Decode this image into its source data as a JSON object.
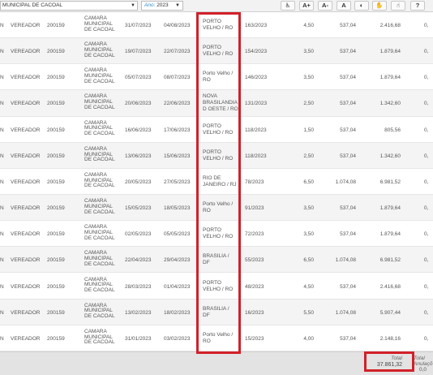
{
  "filters": {
    "entity_value": "MUNICIPAL DE CACOAL",
    "year_label": "Ano:",
    "year_value": "2023"
  },
  "toolbar_buttons": [
    {
      "name": "accessibility-icon",
      "glyph": "♿"
    },
    {
      "name": "font-increase-button",
      "glyph": "A+"
    },
    {
      "name": "font-decrease-button",
      "glyph": "A-"
    },
    {
      "name": "font-reset-button",
      "glyph": "A"
    },
    {
      "name": "contrast-icon",
      "glyph": "◐"
    },
    {
      "name": "libras-icon",
      "glyph": "✋"
    },
    {
      "name": "hand-icon",
      "glyph": "☝"
    },
    {
      "name": "help-icon",
      "glyph": "?"
    }
  ],
  "rows": [
    {
      "first": "N",
      "role": "VEREADOR",
      "code": "200159",
      "orgao": [
        "CAMARA",
        "MUNICIPAL",
        "DE CACOAL"
      ],
      "saida": "31/07/2023",
      "retorno": "04/08/2023",
      "destino": [
        "PORTO",
        "VELHO / RO"
      ],
      "doc": "163/2023",
      "qtd": "4,50",
      "unit": "537,04",
      "total": "2.416,68",
      "last": "0,"
    },
    {
      "first": "N",
      "role": "VEREADOR",
      "code": "200159",
      "orgao": [
        "CAMARA",
        "MUNICIPAL",
        "DE CACOAL"
      ],
      "saida": "19/07/2023",
      "retorno": "22/07/2023",
      "destino": [
        "PORTO",
        "VELHO / RO"
      ],
      "doc": "154/2023",
      "qtd": "3,50",
      "unit": "537,04",
      "total": "1.879,64",
      "last": "0,"
    },
    {
      "first": "N",
      "role": "VEREADOR",
      "code": "200159",
      "orgao": [
        "CAMARA",
        "MUNICIPAL",
        "DE CACOAL"
      ],
      "saida": "05/07/2023",
      "retorno": "08/07/2023",
      "destino": [
        "Porto Velho /",
        "RO"
      ],
      "doc": "146/2023",
      "qtd": "3,50",
      "unit": "537,04",
      "total": "1.879,64",
      "last": "0,"
    },
    {
      "first": "N",
      "role": "VEREADOR",
      "code": "200159",
      "orgao": [
        "CAMARA",
        "MUNICIPAL",
        "DE CACOAL"
      ],
      "saida": "20/06/2023",
      "retorno": "22/06/2023",
      "destino": [
        "NOVA",
        "BRASILANDIA",
        "D OESTE / RO"
      ],
      "doc": "131/2023",
      "qtd": "2,50",
      "unit": "537,04",
      "total": "1.342,60",
      "last": "0,"
    },
    {
      "first": "N",
      "role": "VEREADOR",
      "code": "200159",
      "orgao": [
        "CAMARA",
        "MUNICIPAL",
        "DE CACOAL"
      ],
      "saida": "16/06/2023",
      "retorno": "17/06/2023",
      "destino": [
        "PORTO",
        "VELHO / RO"
      ],
      "doc": "118/2023",
      "qtd": "1,50",
      "unit": "537,04",
      "total": "805,56",
      "last": "0,"
    },
    {
      "first": "N",
      "role": "VEREADOR",
      "code": "200159",
      "orgao": [
        "CAMARA",
        "MUNICIPAL",
        "DE CACOAL"
      ],
      "saida": "13/06/2023",
      "retorno": "15/06/2023",
      "destino": [
        "PORTO",
        "VELHO / RO"
      ],
      "doc": "118/2023",
      "qtd": "2,50",
      "unit": "537,04",
      "total": "1.342,60",
      "last": "0,"
    },
    {
      "first": "N",
      "role": "VEREADOR",
      "code": "200159",
      "orgao": [
        "CAMARA",
        "MUNICIPAL",
        "DE CACOAL"
      ],
      "saida": "20/05/2023",
      "retorno": "27/05/2023",
      "destino": [
        "RIO DE",
        "JANEIRO / RJ"
      ],
      "doc": "78/2023",
      "qtd": "6,50",
      "unit": "1.074,08",
      "total": "6.981,52",
      "last": "0,"
    },
    {
      "first": "N",
      "role": "VEREADOR",
      "code": "200159",
      "orgao": [
        "CAMARA",
        "MUNICIPAL",
        "DE CACOAL"
      ],
      "saida": "15/05/2023",
      "retorno": "18/05/2023",
      "destino": [
        "Porto Velho /",
        "RO"
      ],
      "doc": "91/2023",
      "qtd": "3,50",
      "unit": "537,04",
      "total": "1.879,64",
      "last": "0,"
    },
    {
      "first": "N",
      "role": "VEREADOR",
      "code": "200159",
      "orgao": [
        "CAMARA",
        "MUNICIPAL",
        "DE CACOAL"
      ],
      "saida": "02/05/2023",
      "retorno": "05/05/2023",
      "destino": [
        "PORTO",
        "VELHO / RO"
      ],
      "doc": "72/2023",
      "qtd": "3,50",
      "unit": "537,04",
      "total": "1.879,64",
      "last": "0,"
    },
    {
      "first": "N",
      "role": "VEREADOR",
      "code": "200159",
      "orgao": [
        "CAMARA",
        "MUNICIPAL",
        "DE CACOAL"
      ],
      "saida": "22/04/2023",
      "retorno": "29/04/2023",
      "destino": [
        "BRASILIA /",
        "DF"
      ],
      "doc": "55/2023",
      "qtd": "6,50",
      "unit": "1.074,08",
      "total": "6.981,52",
      "last": "0,"
    },
    {
      "first": "N",
      "role": "VEREADOR",
      "code": "200159",
      "orgao": [
        "CAMARA",
        "MUNICIPAL",
        "DE CACOAL"
      ],
      "saida": "28/03/2023",
      "retorno": "01/04/2023",
      "destino": [
        "PORTO",
        "VELHO / RO"
      ],
      "doc": "48/2023",
      "qtd": "4,50",
      "unit": "537,04",
      "total": "2.416,68",
      "last": "0,"
    },
    {
      "first": "N",
      "role": "VEREADOR",
      "code": "200159",
      "orgao": [
        "CAMARA",
        "MUNICIPAL",
        "DE CACOAL"
      ],
      "saida": "13/02/2023",
      "retorno": "18/02/2023",
      "destino": [
        "BRASILIA /",
        "DF"
      ],
      "doc": "16/2023",
      "qtd": "5,50",
      "unit": "1.074,08",
      "total": "5.907,44",
      "last": "0,"
    },
    {
      "first": "N",
      "role": "VEREADOR",
      "code": "200159",
      "orgao": [
        "CAMARA",
        "MUNICIPAL",
        "DE CACOAL"
      ],
      "saida": "31/01/2023",
      "retorno": "03/02/2023",
      "destino": [
        "Porto Velho /",
        "RO"
      ],
      "doc": "15/2023",
      "qtd": "4,00",
      "unit": "537,04",
      "total": "2.148,16",
      "last": "0,"
    }
  ],
  "footer": {
    "total_label": "Total",
    "total_value": "37.861,32",
    "anulacao_label_1": "Total",
    "anulacao_label_2": "Anulaçõ",
    "anulacao_value": "0,0"
  },
  "annotation_color": "#d2202a"
}
